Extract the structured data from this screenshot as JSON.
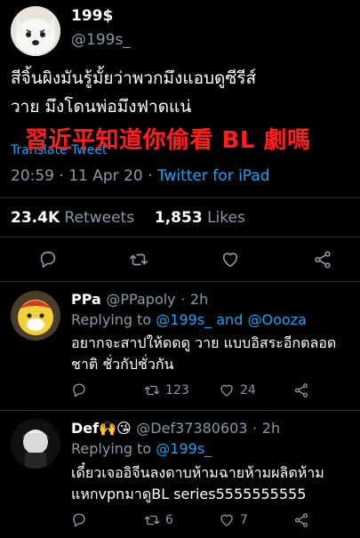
{
  "tweet": {
    "display_name": "199$",
    "handle": "@199s_",
    "text_line1": "สีจิ้นผิงมันรู้มั้ยว่าพวกมึงแอบดูซีรีส์",
    "text_line2": "วาย มึงโดนพ่อมึงฟาดแน่",
    "overlay_text": "習近平知道你偷看 BL 劇嗎",
    "translate_label": "Translate Tweet",
    "time": "20:59",
    "date": "11 Apr 20",
    "source": "Twitter for iPad",
    "retweets_count": "23.4K",
    "retweets_label": "Retweets",
    "likes_count": "1,853",
    "likes_label": "Likes"
  },
  "actions": {
    "icons": [
      "reply-icon",
      "retweet-icon",
      "like-icon",
      "share-icon"
    ]
  },
  "replies": [
    {
      "display_name": "PPa",
      "handle": "@PPapoly",
      "time": "2h",
      "replying_prefix": "Replying to",
      "replying_to_1": "@199s_",
      "replying_and": "and",
      "replying_to_2": "@Oooza",
      "text_line1": "อยากจะสาปให้ดดดู วาย แบบอิสระอีกตลอด",
      "text_line2": "ชาติ ชั่วกัปชั่วกัน",
      "retweets": "123",
      "likes": "24"
    },
    {
      "display_name": "Def🙌😘",
      "handle": "@Def37380603",
      "time": "2h",
      "replying_prefix": "Replying to",
      "replying_to_1": "@199s_",
      "text_line1": "เดี๋ยวเจออิจีนลงดาบห้ามฉายห้ามผลิตห้าม",
      "text_line2": "แหกvpnมาดูBL series5555555555",
      "retweets": "6",
      "likes": "7"
    }
  ],
  "colors": {
    "background": "#000000",
    "muted": "#8899a6",
    "link": "#1da1f2",
    "overlay_red": "#ff1d1d"
  }
}
